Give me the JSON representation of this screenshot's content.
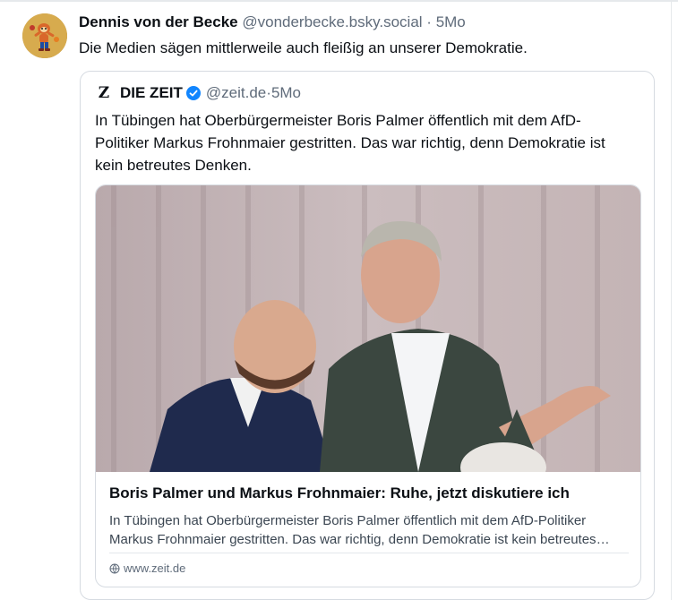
{
  "post": {
    "author_name": "Dennis von der Becke",
    "author_handle": "@vonderbecke.bsky.social",
    "separator": "·",
    "time": "5Mo",
    "text": "Die Medien sägen mittlerweile auch fleißig an unserer Demokratie."
  },
  "quote": {
    "logo_letter": "Z",
    "author_name": "DIE ZEIT",
    "author_handle": "@zeit.de",
    "separator": "·",
    "time": "5Mo",
    "text": "In Tübingen hat Oberbürgermeister Boris Palmer öffentlich mit dem AfD-Politiker Markus Frohnmaier gestritten. Das war richtig, denn Demokratie ist kein betreutes Denken.",
    "verified_color": "#1185fe",
    "card": {
      "title": "Boris Palmer und Markus Frohnmaier: Ruhe, jetzt diskutiere ich",
      "description": "In Tübingen hat Oberbürgermeister Boris Palmer öffentlich mit dem AfD-Politiker Markus Frohnmaier gestritten. Das war richtig, denn Demokratie ist kein betreutes Denken.",
      "domain": "www.zeit.de"
    }
  }
}
